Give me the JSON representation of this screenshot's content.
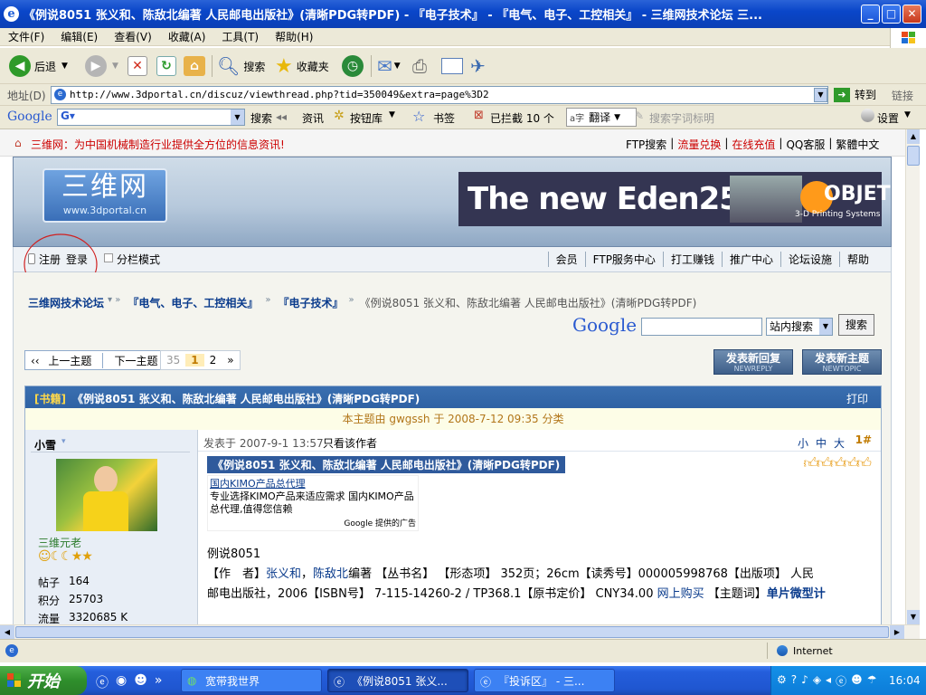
{
  "window": {
    "title": "《例说8051 张义和、陈敌北编著 人民邮电出版社》(清晰PDG转PDF) - 『电子技术』 - 『电气、电子、工控相关』 - 三维网技术论坛 三...",
    "min": "_",
    "max": "□",
    "close": "✕"
  },
  "menu": [
    "文件(F)",
    "编辑(E)",
    "查看(V)",
    "收藏(A)",
    "工具(T)",
    "帮助(H)"
  ],
  "toolbar": {
    "back": "后退",
    "search": "搜索",
    "favorites": "收藏夹"
  },
  "address": {
    "label": "地址(D)",
    "url": "http://www.3dportal.cn/discuz/viewthread.php?tid=350049&extra=page%3D2",
    "go": "转到",
    "links": "链接"
  },
  "googlebar": {
    "logo": "Google",
    "search": "搜索",
    "news": "资讯",
    "buttons": "按钮库",
    "bookmarks": "书签",
    "blocked": "已拦截 10 个",
    "translate": "翻译",
    "highlight": "搜索字词标明",
    "settings": "设置"
  },
  "site": {
    "top_notice": "三维网：为中国机械制造行业提供全方位的信息资讯!",
    "top_links": [
      "FTP搜索",
      "流量兑换",
      "在线充值",
      "QQ客服",
      "繁體中文"
    ],
    "logo_text": "三维网",
    "logo_url": "www.3dportal.cn",
    "ad_text": "The new Eden250™",
    "ad_brand": "OBJET",
    "ad_sub": "3-D Printing Systems",
    "nav_left": [
      "注册",
      "登录",
      "分栏模式"
    ],
    "nav_right": [
      "会员",
      "FTP服务中心",
      "打工赚钱",
      "推广中心",
      "论坛设施",
      "帮助"
    ],
    "breadcrumb": [
      "三维网技术论坛",
      "『电气、电子、工控相关』",
      "『电子技术』",
      "《例说8051 张义和、陈敌北编著 人民邮电出版社》(清晰PDG转PDF)"
    ],
    "site_search_option": "站内搜索",
    "search_btn": "搜索",
    "google_logo": "Google",
    "prev_next": [
      "上一主题",
      "下一主题"
    ],
    "pages": [
      "35",
      "1",
      "2",
      "»"
    ],
    "reply_btn": "发表新回复",
    "reply_sub": "NEWREPLY",
    "topic_btn": "发表新主题",
    "topic_sub": "NEWTOPIC",
    "thread_tag": "[书籍]",
    "thread_title": "《例说8051 张义和、陈敌北编著 人民邮电出版社》(清晰PDG转PDF)",
    "print": "打印",
    "classified": "本主题由 gwgssh 于 2008-7-12 09:35 分类",
    "author": "小雪",
    "author_title": "三维元老",
    "posts_label": "帖子",
    "posts": "164",
    "points_label": "积分",
    "points": "25703",
    "traffic_label": "流量",
    "traffic": "3320685 K",
    "post_time": "发表于 2007-9-1 13:57",
    "only_author": "只看该作者",
    "font_sizes": [
      "小",
      "中",
      "大"
    ],
    "floor": "1#",
    "post_title": "《例说8051 张义和、陈敌北编著 人民邮电出版社》(清晰PDG转PDF)",
    "ad_link": "国内KIMO产品总代理",
    "ad_desc": "专业选择KIMO产品来适应需求 国内KIMO产品总代理,值得您信赖",
    "ad_by": "Google 提供的广告",
    "body_line1": "例说8051",
    "body_line2_a": "【作　者】",
    "body_line2_b": "张义和",
    "body_line2_c": "，",
    "body_line2_d": "陈敌北",
    "body_line2_e": "编著 【丛书名】 【形态项】 352页；26cm【读秀号】000005998768【出版项】 人民",
    "body_line3_a": "邮电出版社，2006【ISBN号】 7-115-14260-2 / TP368.1【原书定价】 CNY34.00 ",
    "body_line3_b": "网上购买",
    "body_line3_c": " 【主题词】",
    "body_line3_d": "单片微型计"
  },
  "status": {
    "zone": "Internet"
  },
  "taskbar": {
    "start": "开始",
    "tasks": [
      "宽带我世界",
      "《例说8051 张义...",
      "『投诉区』 - 三..."
    ],
    "time": "16:04"
  },
  "colors": {
    "xp_blue": "#0a46c9",
    "link_blue": "#0a3b8c",
    "red_text": "#cc0000",
    "start_green": "#2f8f2c"
  }
}
